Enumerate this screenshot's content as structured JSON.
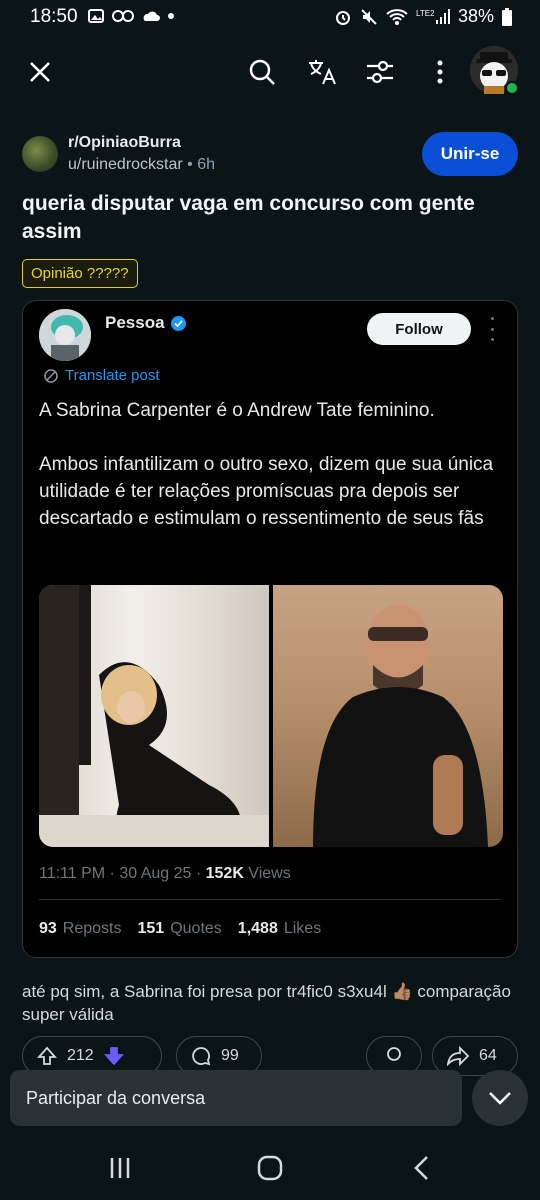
{
  "status_bar": {
    "time": "18:50",
    "battery": "38%",
    "network": "LTE2"
  },
  "app_bar": {
    "close_icon": "close-icon",
    "search_icon": "search-icon",
    "translate_icon": "translate-icon",
    "filter_icon": "tune-icon",
    "more_icon": "more-vertical-icon"
  },
  "post": {
    "subreddit": "r/OpiniaoBurra",
    "author": "u/ruinedrockstar",
    "separator": "•",
    "time": "6h",
    "join_label": "Unir-se",
    "title": "queria disputar vaga em concurso com gente assim",
    "flair": "Opinião ?????",
    "body": "até pq sim, a Sabrina foi presa por tr4fic0 s3xu4l 👍🏽 comparação super válida"
  },
  "tweet": {
    "name": "Pessoa",
    "follow_label": "Follow",
    "translate_label": "Translate post",
    "paragraphs": [
      "A Sabrina Carpenter é o Andrew Tate feminino.",
      "Ambos infantilizam o outro sexo, dizem que sua única utilidade é ter relações promíscuas pra depois ser descartado e estimulam o ressentimento de seus fãs"
    ],
    "timestamp": "11:11 PM · 30 Aug 25 · ",
    "views_count": "152K",
    "views_label": " Views",
    "reposts_count": "93",
    "reposts_label": "Reposts",
    "quotes_count": "151",
    "quotes_label": "Quotes",
    "likes_count": "1,488",
    "likes_label": "Likes"
  },
  "actions": {
    "upvotes": "212",
    "comments": "99",
    "shares": "64"
  },
  "join_conversation": {
    "label": "Participar da conversa"
  },
  "colors": {
    "background": "#0b1416",
    "join_button": "#0a4fd6",
    "flair": "#e9d528",
    "twitter_blue": "#1d9bf0"
  }
}
